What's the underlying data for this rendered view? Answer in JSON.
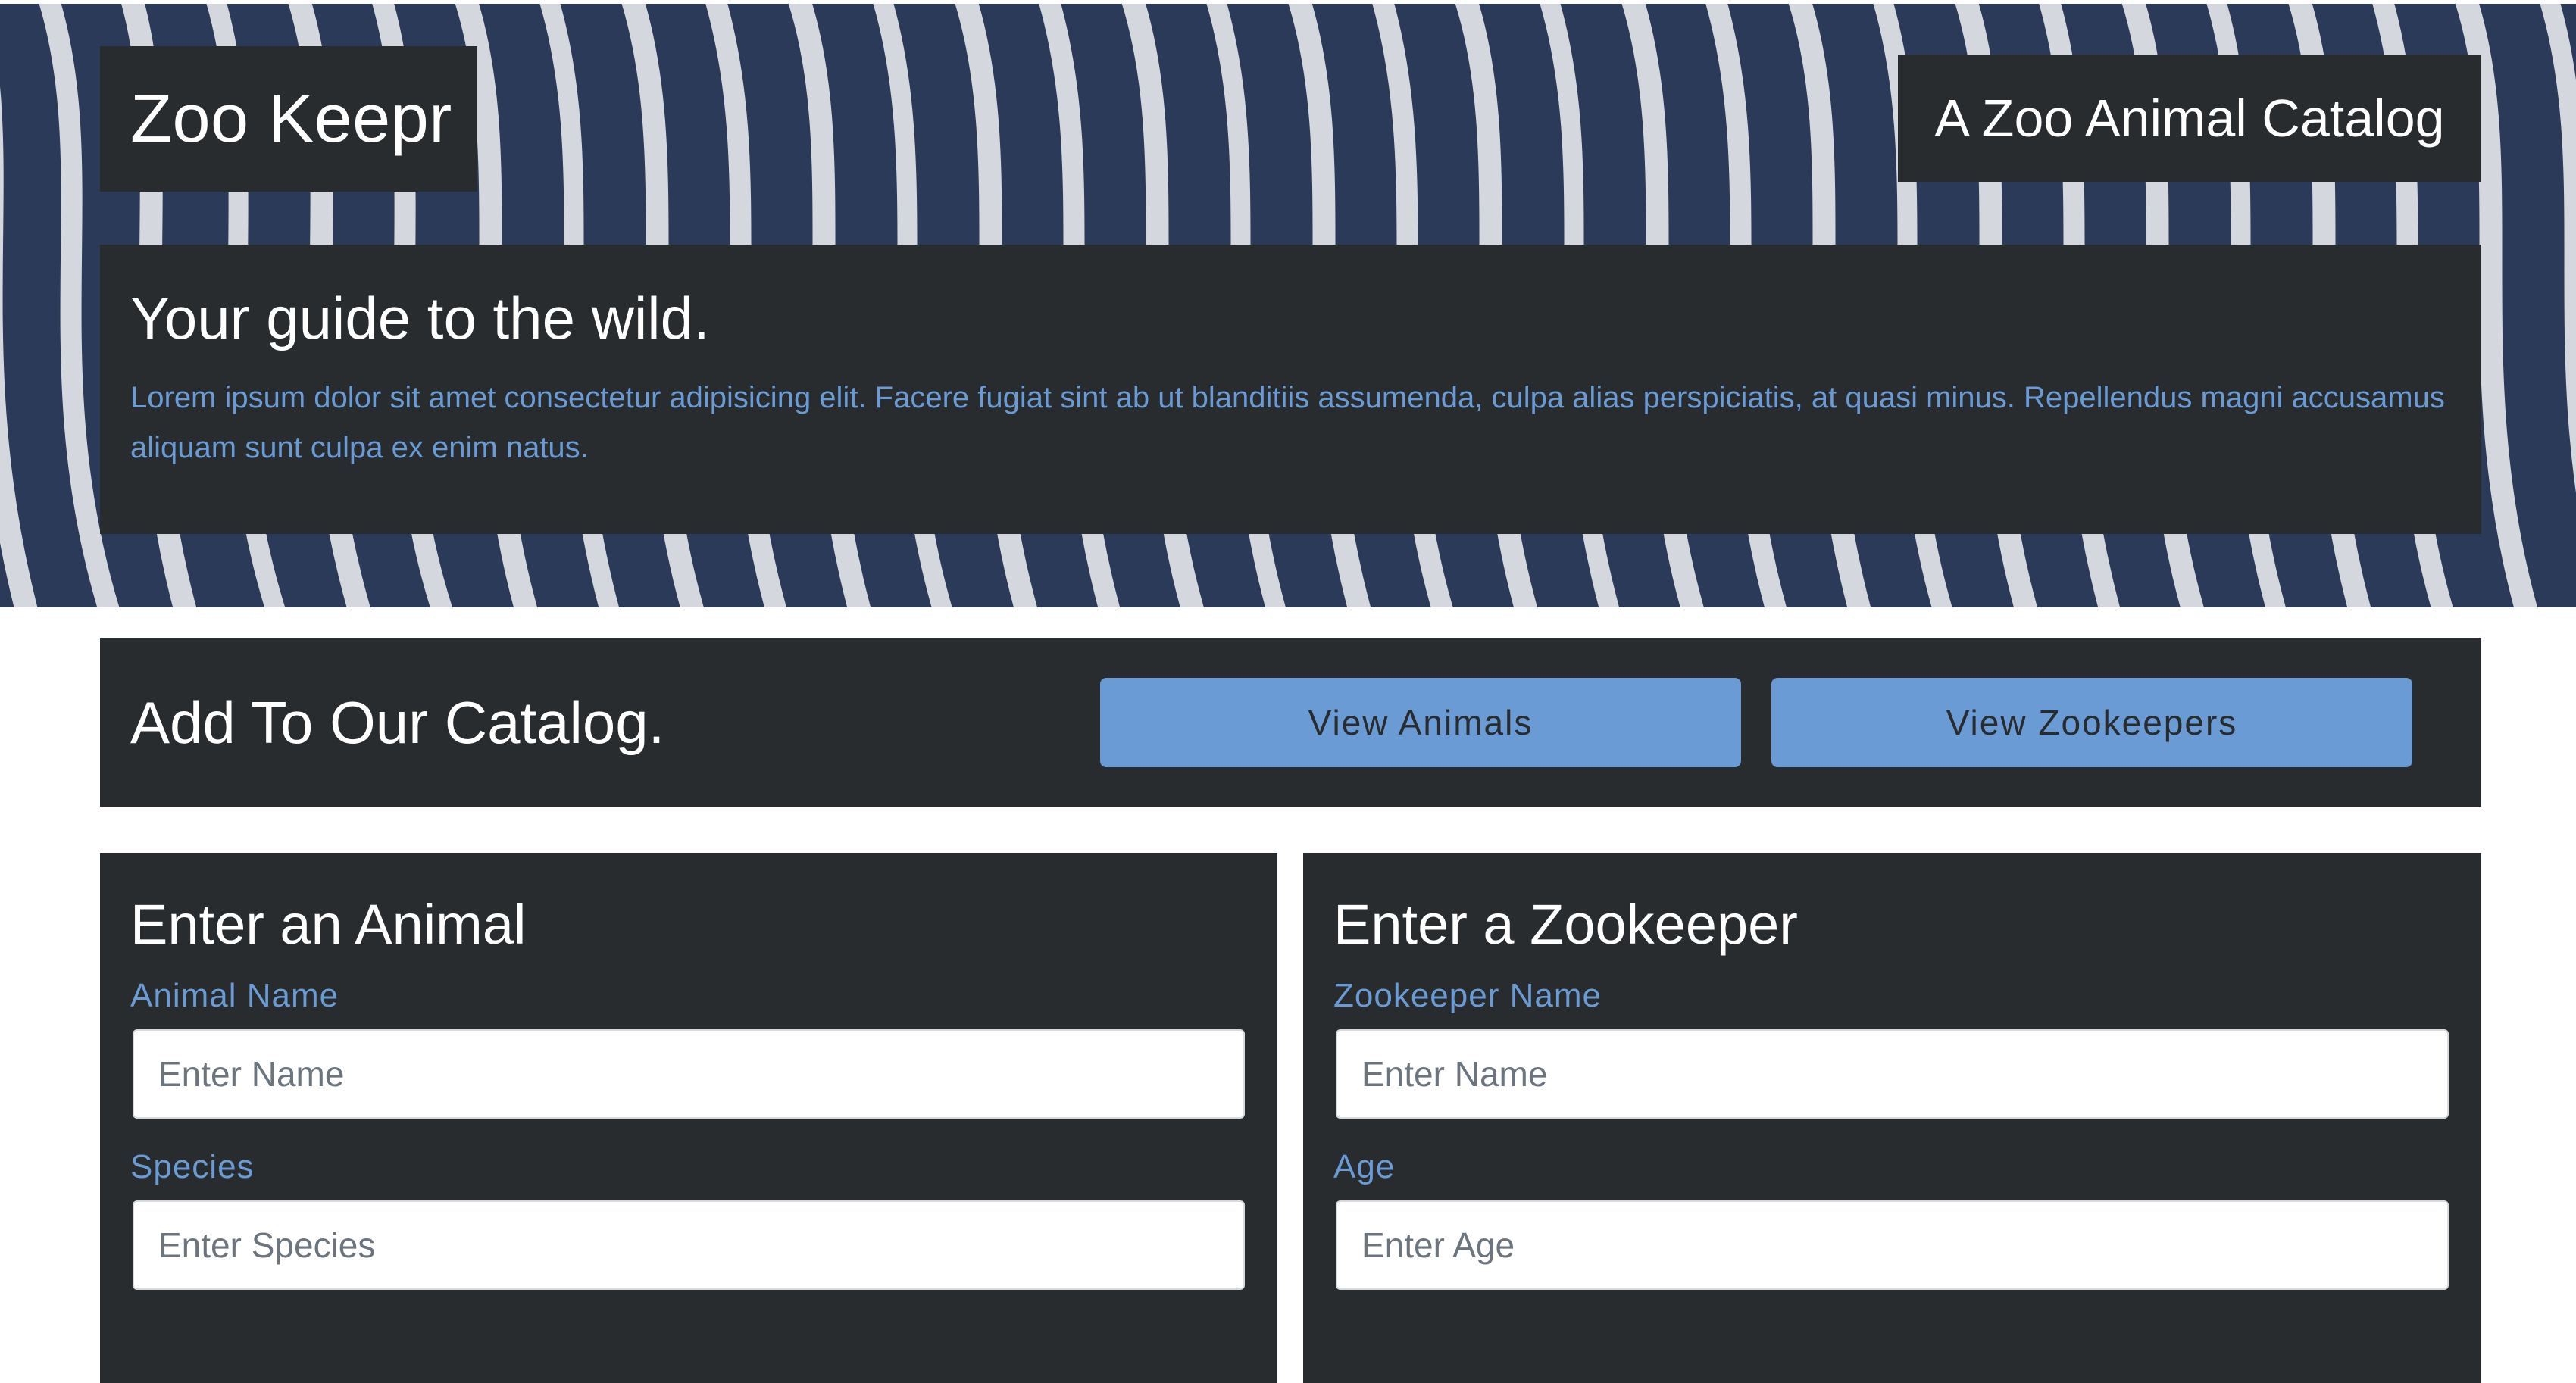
{
  "header": {
    "brand": "Zoo Keepr",
    "tagline": "A Zoo Animal Catalog",
    "intro_heading": "Your guide to the wild.",
    "intro_text": "Lorem ipsum dolor sit amet consectetur adipisicing elit. Facere fugiat sint ab ut blanditiis assumenda, culpa alias perspiciatis, at quasi minus. Repellendus magni accusamus aliquam sunt culpa ex enim natus."
  },
  "catalog": {
    "title": "Add To Our Catalog.",
    "view_animals_label": "View Animals",
    "view_zookeepers_label": "View Zookeepers"
  },
  "animal_form": {
    "heading": "Enter an Animal",
    "name_label": "Animal Name",
    "name_placeholder": "Enter Name",
    "name_value": "",
    "species_label": "Species",
    "species_placeholder": "Enter Species",
    "species_value": ""
  },
  "zookeeper_form": {
    "heading": "Enter a Zookeeper",
    "name_label": "Zookeeper Name",
    "name_placeholder": "Enter Name",
    "name_value": "",
    "age_label": "Age",
    "age_placeholder": "Enter Age",
    "age_value": ""
  },
  "colors": {
    "panel": "#282c2f",
    "accent": "#6a9bd4",
    "hero_base": "#2b3a59",
    "stripe": "#e3e6ea",
    "text_light": "#ffffff"
  }
}
